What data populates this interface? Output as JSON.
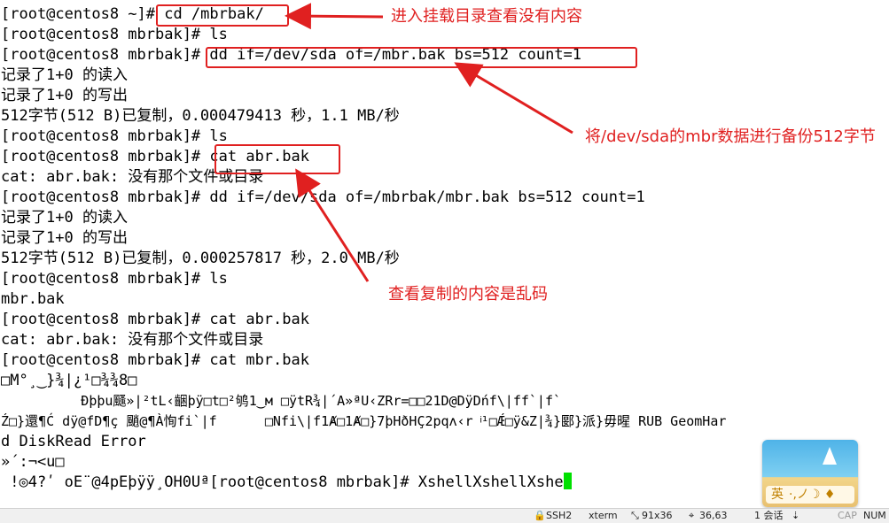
{
  "terminal": {
    "lines": [
      "[root@centos8 ~]# cd /mbrbak/",
      "[root@centos8 mbrbak]# ls",
      "[root@centos8 mbrbak]# dd if=/dev/sda of=/mbr.bak bs=512 count=1",
      "记录了1+0 的读入",
      "记录了1+0 的写出",
      "512字节(512 B)已复制，0.000479413 秒，1.1 MB/秒",
      "[root@centos8 mbrbak]# ls",
      "[root@centos8 mbrbak]# cat abr.bak",
      "cat: abr.bak: 没有那个文件或目录",
      "[root@centos8 mbrbak]# dd if=/dev/sda of=/mbrbak/mbr.bak bs=512 count=1",
      "记录了1+0 的读入",
      "记录了1+0 的写出",
      "512字节(512 B)已复制，0.000257817 秒，2.0 MB/秒",
      "[root@centos8 mbrbak]# ls",
      "mbr.bak",
      "[root@centos8 mbrbak]# cat abr.bak",
      "cat: abr.bak: 没有那个文件或目录",
      "[root@centos8 mbrbak]# cat mbr.bak",
      "□M°¸‿}¾|¿¹□¾¾8□",
      "          Ðþþu颾»|²tL‹齫þÿ□t□²鸲1‿м □ÿtR¾|´A»ªU‹ZRr=□□21D@DÿDńf\\|ff`|f`",
      "Ź□}還¶Ć dÿ@fD¶ç 颵@¶À恂fi`|f      □Nfi\\|f1Ⱥ□1Ⱥ□}7þHðHÇ2pqʌ‹r ͥ¹□Ǽ□ÿ&Z|¾}郾}派}毋暒 RUB GeomHar",
      "d DiskRead Error",
      "»´:¬<u□",
      " !◎4?ʹ oE¨@4pEþÿÿ¸OH0Uª[root@centos8 mbrbak]# XshellXshellXshe"
    ]
  },
  "annotations": {
    "a1": "进入挂载目录查看没有内容",
    "a2": "将/dev/sda的mbr数据进行备份512字节",
    "a3": "查看复制的内容是乱码"
  },
  "ime": {
    "lang": "英",
    "glyphs": "·,ノ☽ ♦"
  },
  "status": {
    "protocol": "SSH2",
    "term": "xterm",
    "size": "91x36",
    "pos": "36,63",
    "sessions": "1 会话",
    "caps": "CAP",
    "num": "NUM"
  },
  "colors": {
    "highlight": "#e02020",
    "cursor": "#00e000"
  }
}
